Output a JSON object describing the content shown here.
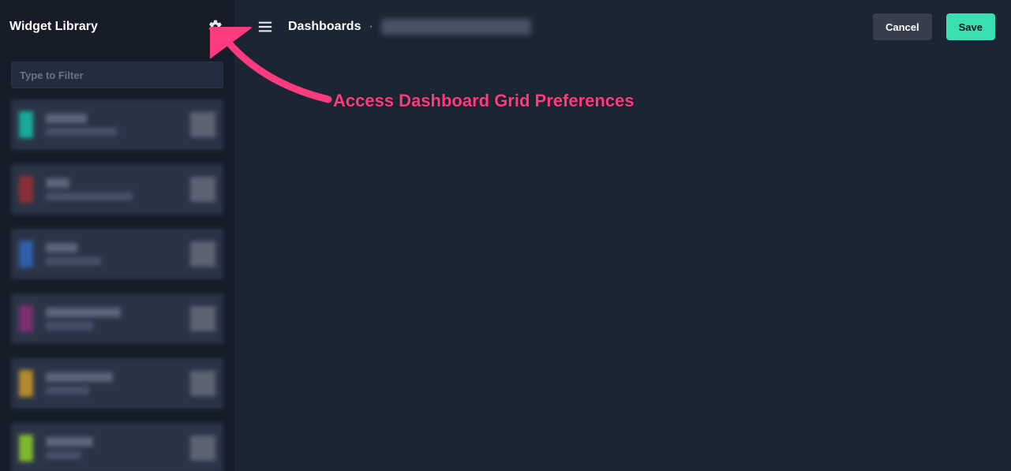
{
  "sidebar": {
    "title": "Widget Library",
    "filter_placeholder": "Type to Filter",
    "widgets": [
      {
        "swatch": "#1aa99a",
        "line1_w": 52,
        "line2_w": 90
      },
      {
        "swatch": "#8a2f3a",
        "line1_w": 30,
        "line2_w": 110
      },
      {
        "swatch": "#2f5fa8",
        "line1_w": 40,
        "line2_w": 70
      },
      {
        "swatch": "#7c2f72",
        "line1_w": 95,
        "line2_w": 60
      },
      {
        "swatch": "#b38a2f",
        "line1_w": 85,
        "line2_w": 55
      },
      {
        "swatch": "#7eb82f",
        "line1_w": 60,
        "line2_w": 45
      }
    ]
  },
  "topbar": {
    "breadcrumb_root": "Dashboards",
    "breadcrumb_sep": "·",
    "cancel_label": "Cancel",
    "save_label": "Save"
  },
  "annotation": {
    "text": "Access Dashboard Grid Preferences"
  },
  "grid": {
    "col_xs": [
      0,
      183,
      201,
      383,
      401,
      584,
      601,
      784,
      802,
      963
    ],
    "row_ys": [
      0,
      88,
      106,
      194,
      278,
      296,
      367,
      385,
      456,
      473
    ]
  },
  "colors": {
    "grid_line": "#3fb7a4",
    "accent_save": "#3be0b2",
    "annotation": "#ff3b7f"
  }
}
